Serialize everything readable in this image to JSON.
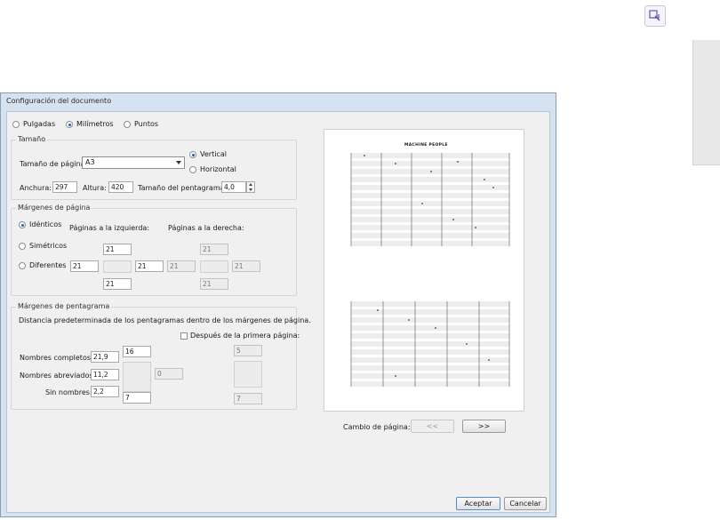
{
  "dialog": {
    "title": "Configuración del documento"
  },
  "units": {
    "options": [
      "Pulgadas",
      "Milímetros",
      "Puntos"
    ],
    "selected": "Milímetros"
  },
  "size": {
    "legend": "Tamaño",
    "page_size_label": "Tamaño de página:",
    "page_size_value": "A3",
    "orientation": {
      "vertical": "Vertical",
      "horizontal": "Horizontal",
      "selected": "Vertical"
    },
    "width_label": "Anchura:",
    "width_value": "297",
    "height_label": "Altura:",
    "height_value": "420",
    "staff_size_label": "Tamaño del pentagrama:",
    "staff_size_value": "4,0"
  },
  "page_margins": {
    "legend": "Márgenes de página",
    "options": {
      "identical": "Idénticos",
      "symmetric": "Simétricos",
      "different": "Diferentes"
    },
    "selected": "Idénticos",
    "left_pages_label": "Páginas a la izquierda:",
    "right_pages_label": "Páginas a la derecha:",
    "left_top": "21",
    "left_left": "21",
    "left_right": "21",
    "left_bottom": "21",
    "right_top": "21",
    "right_left": "21",
    "right_right": "21",
    "right_bottom": "21"
  },
  "staff_margins": {
    "legend": "Márgenes de pentagrama",
    "description": "Distancia predeterminada de los pentagramas dentro de los márgenes de página.",
    "after_first_page_label": "Después de la primera página:",
    "full_names_label": "Nombres completos:",
    "full_names_value": "21,9",
    "abbrev_names_label": "Nombres abreviados:",
    "abbrev_names_value": "11,2",
    "no_names_label": "Sin nombres:",
    "no_names_value": "2,2",
    "top_value": "16",
    "bottom_value": "7",
    "abbrev_inner_value": "0",
    "after_top_value": "5",
    "after_bottom_value": "7"
  },
  "preview": {
    "score_title": "MACHINE PEOPLE"
  },
  "page_change": {
    "label": "Cambio de página:",
    "prev": "<<",
    "next": ">>"
  },
  "buttons": {
    "ok": "Aceptar",
    "cancel": "Cancelar"
  },
  "colors": {
    "dialog_frame": "#d7e2f1",
    "client_bg": "#f0f0f0",
    "accent": "#1e5fb4"
  }
}
